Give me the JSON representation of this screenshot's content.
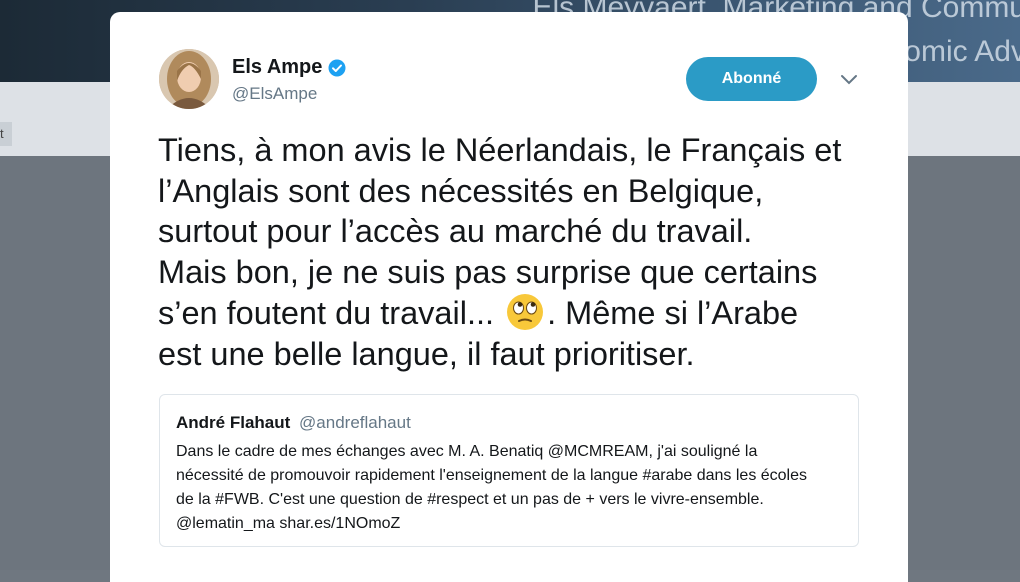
{
  "background": {
    "banner_text_line1": "Els Meyvaert, Marketing and Commu",
    "banner_text_line2": "omic Adv",
    "strip_chip_text": "t"
  },
  "tweet": {
    "author_name": "Els Ampe",
    "author_handle": "@ElsAmpe",
    "verified": true,
    "follow_label": "Abonné",
    "text_before_emoji": "Tiens, à mon avis le Néerlandais, le Français et\nl’Anglais sont des nécessités en Belgique,\nsurtout pour l’accès au marché du travail.\nMais bon, je ne suis pas surprise que certains\ns’en foutent du travail... ",
    "emoji_name": "face-with-rolling-eyes",
    "text_after_emoji": ". Même si l’Arabe\nest une belle langue, il faut prioritiser.",
    "accent_color": "#2b9bc6"
  },
  "quoted_tweet": {
    "author_name": "André Flahaut",
    "author_handle": "@andreflahaut",
    "text": "Dans le cadre de mes échanges avec M. A. Benatiq @MCMREAM, j'ai souligné la nécessité de promouvoir rapidement l'enseignement de la langue #arabe dans les écoles de la #FWB. C'est une question de #respect et un pas de + vers le vivre-ensemble. @lematin_ma shar.es/1NOmoZ"
  }
}
